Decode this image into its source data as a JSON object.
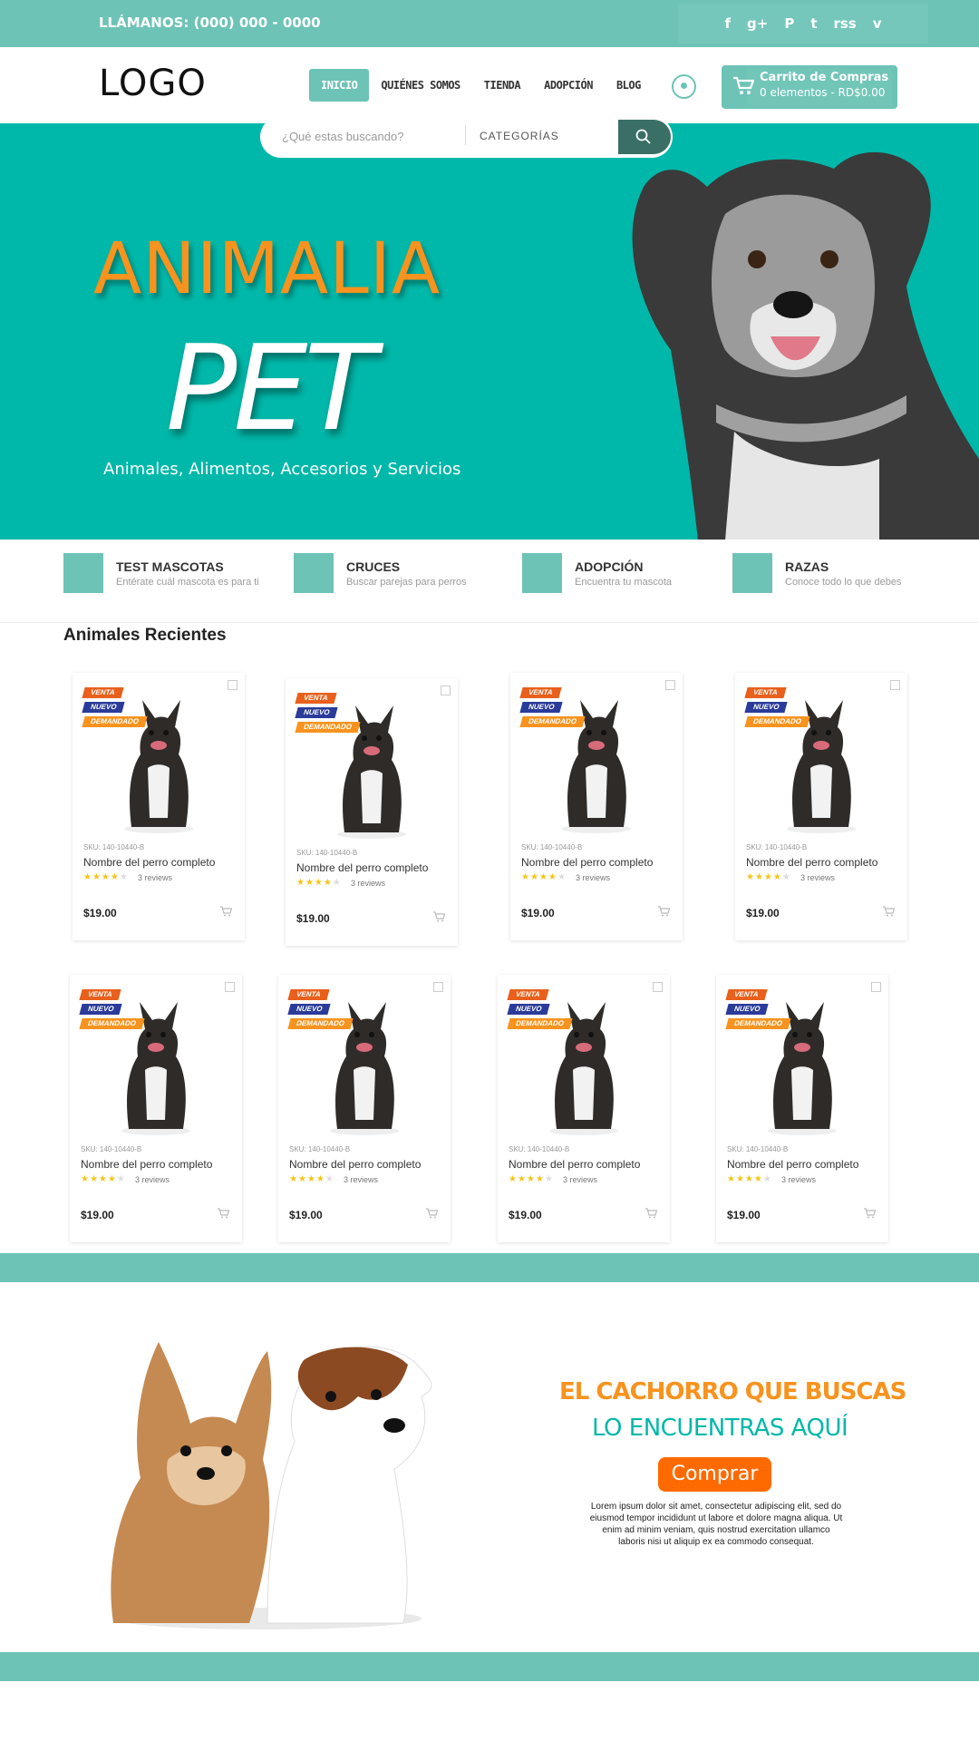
{
  "topbar": {
    "phone": "LLÁMANOS: (000) 000 - 0000",
    "social": [
      "f",
      "g+",
      "P",
      "t",
      "rss",
      "v"
    ]
  },
  "header": {
    "logo": "LOGO",
    "nav": [
      "INICIO",
      "QUIÉNES SOMOS",
      "TIENDA",
      "ADOPCIÓN",
      "BLOG"
    ],
    "active_nav": "INICIO",
    "cart_title": "Carrito de Compras",
    "cart_sub": "0 elementos - RD$0.00"
  },
  "search": {
    "placeholder": "¿Qué estas buscando?",
    "category": "CATEGORÍAS"
  },
  "hero": {
    "title1": "ANIMALIA",
    "title2": "PET",
    "subtitle": "Animales, Alimentos, Accesorios y Servicios"
  },
  "features": [
    {
      "title": "TEST MASCOTAS",
      "desc": "Entérate cuál mascota es para ti"
    },
    {
      "title": "CRUCES",
      "desc": "Buscar parejas para perros"
    },
    {
      "title": "ADOPCIÓN",
      "desc": "Encuentra tu mascota"
    },
    {
      "title": "RAZAS",
      "desc": "Conoce todo lo que debes"
    }
  ],
  "section_title": "Animales Recientes",
  "product": {
    "badges": [
      "VENTA",
      "NUEVO",
      "DEMANDADO"
    ],
    "sku": "SKU: 140-10440-B",
    "name": "Nombre del perro completo",
    "reviews": "3 reviews",
    "price": "$19.00",
    "rating": 4
  },
  "promo": {
    "line1": "EL CACHORRO QUE BUSCAS",
    "line2": "LO ENCUENTRAS AQUÍ",
    "button": "Comprar",
    "text": "Lorem ipsum dolor sit amet, consectetur adipiscing elit, sed do eiusmod tempor incididunt ut labore et dolore magna aliqua. Ut enim ad minim veniam, quis nostrud exercitation ullamco laboris nisi ut aliquip ex ea commodo consequat."
  },
  "colors": {
    "teal": "#6dc3b6",
    "hero": "#00b8a9",
    "orange": "#f7931e",
    "button": "#ff6a00"
  }
}
